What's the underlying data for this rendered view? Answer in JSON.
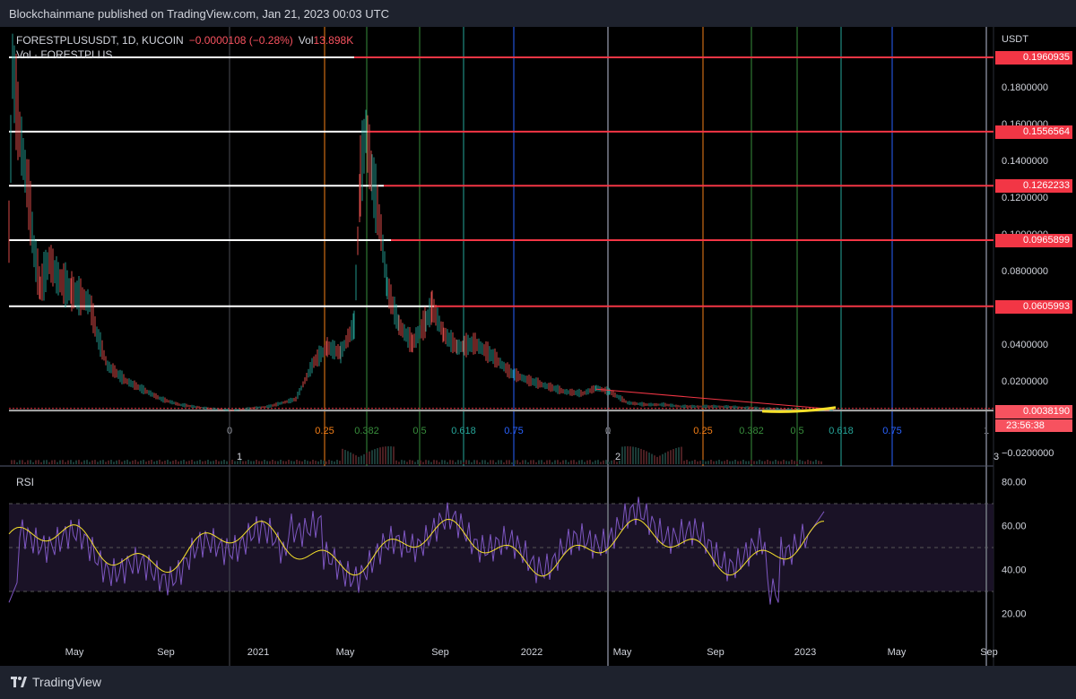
{
  "header": {
    "publisher_text": "Blockchainmane published on TradingView.com, Jan 21, 2023 00:03 UTC"
  },
  "legend": {
    "symbol": "FORESTPLUSUSDT, 1D, KUCOIN",
    "change": "−0.0000108 (−0.28%)",
    "vol_label": "Vol",
    "vol_value": "13.898K",
    "vol_series": "Vol · FORESTPLUS"
  },
  "rsi_label": "RSI",
  "price_axis": {
    "unit": "USDT",
    "ticks": [
      "0.1800000",
      "0.1600000",
      "0.1400000",
      "0.1200000",
      "0.1000000",
      "0.0800000",
      "0.0400000",
      "0.0200000",
      "−0.0200000"
    ],
    "tick_values": [
      0.18,
      0.16,
      0.14,
      0.12,
      0.1,
      0.08,
      0.04,
      0.02,
      -0.02
    ]
  },
  "horizontal_levels": [
    {
      "label": "0.1960935",
      "value": 0.1960935
    },
    {
      "label": "0.1556564",
      "value": 0.1556564
    },
    {
      "label": "0.1262233",
      "value": 0.1262233
    },
    {
      "label": "0.0965899",
      "value": 0.0965899
    },
    {
      "label": "0.0605993",
      "value": 0.0605993
    }
  ],
  "current_price": {
    "label": "0.0038190",
    "value": 0.003819,
    "countdown": "23:56:38"
  },
  "fib_time_labels_1": [
    "0",
    "0.25",
    "0.382",
    "0.5",
    "0.618",
    "0.75",
    "1"
  ],
  "fib_time_labels_2": [
    "0",
    "0.25",
    "0.382",
    "0.5",
    "0.618",
    "0.75",
    "1"
  ],
  "cycle_labels": [
    "1",
    "2",
    "3"
  ],
  "rsi_axis": {
    "ticks": [
      "80.00",
      "60.00",
      "40.00",
      "20.00"
    ],
    "values": [
      80,
      60,
      40,
      20
    ]
  },
  "time_axis": [
    "May",
    "Sep",
    "2021",
    "May",
    "Sep",
    "2022",
    "May",
    "Sep",
    "2023",
    "May",
    "Sep"
  ],
  "colors": {
    "background": "#000000",
    "panel": "#1e222d",
    "up": "#26a69a",
    "down": "#ef5350",
    "level_line": "#ffffff",
    "level_extension": "#f23645",
    "fib_orange": "#f57f17",
    "fib_green": "#388e3c",
    "fib_teal": "#26a69a",
    "fib_blue": "#2962ff",
    "rsi_line": "#7e57c2",
    "rsi_ma": "#f5e02a",
    "price_tag": "#f23645"
  },
  "footer": {
    "brand": "TradingView"
  }
}
